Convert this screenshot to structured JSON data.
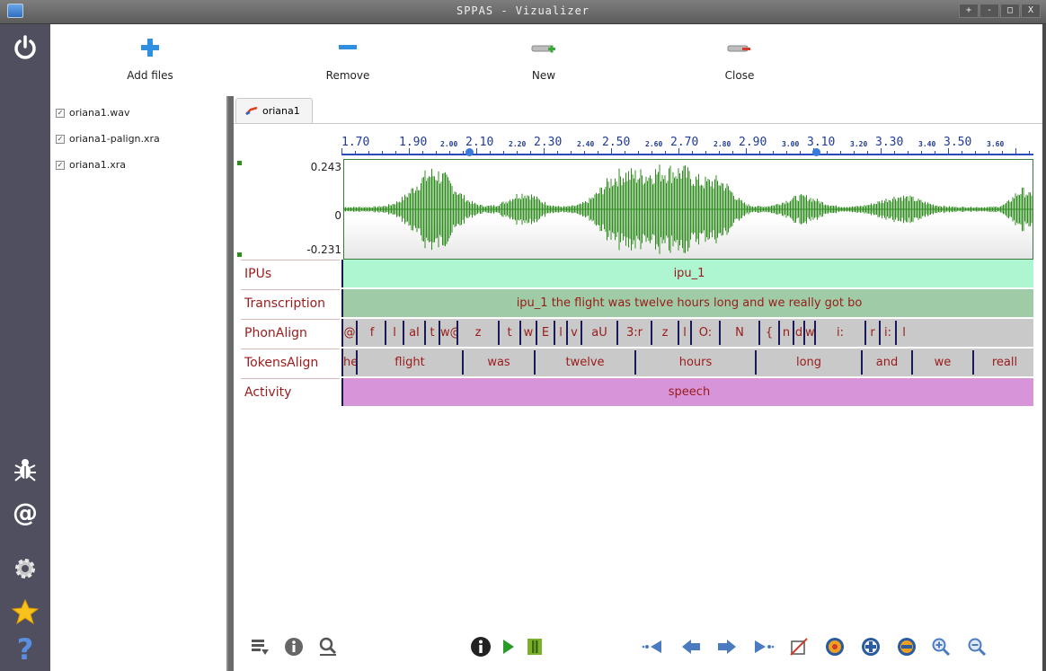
{
  "window": {
    "title": "SPPAS - Vizualizer",
    "controls": [
      "+",
      "-",
      "□",
      "X"
    ]
  },
  "sidebar": {
    "top": {
      "icon": "power-icon"
    },
    "bottom": [
      {
        "icon": "bug-icon"
      },
      {
        "icon": "at-sign-icon"
      },
      {
        "icon": "gear-icon"
      },
      {
        "icon": "star-icon"
      },
      {
        "icon": "help-icon"
      }
    ]
  },
  "toolbar": {
    "add_label": "Add files",
    "remove_label": "Remove",
    "new_label": "New",
    "close_label": "Close"
  },
  "files": [
    {
      "name": "oriana1.wav",
      "checked": true
    },
    {
      "name": "oriana1-palign.xra",
      "checked": true
    },
    {
      "name": "oriana1.xra",
      "checked": true
    }
  ],
  "document": {
    "tab_label": "oriana1",
    "ruler": {
      "major": [
        "1.70",
        "1.90",
        "2.10",
        "2.30",
        "2.50",
        "2.70",
        "2.90",
        "3.10",
        "3.30",
        "3.50"
      ],
      "minor": [
        "2.00",
        "2.20",
        "2.40",
        "2.60",
        "2.80",
        "3.00",
        "3.20",
        "3.40",
        "3.60"
      ]
    },
    "waveform": {
      "ymax": "0.243",
      "yzero": "0",
      "ymin": "-0.231",
      "color": "#2e8b1e"
    },
    "tiers": [
      {
        "name": "IPUs",
        "color": "#aef5d2",
        "annotations": [
          {
            "label": "ipu_1"
          }
        ]
      },
      {
        "name": "Transcription",
        "color": "#9fcca6",
        "annotations": [
          {
            "label": "ipu_1 the flight was twelve hours long and we really got bo"
          }
        ]
      },
      {
        "name": "PhonAlign",
        "color": "#c9c9c9",
        "annotations": [
          {
            "label": "@"
          },
          {
            "label": "f"
          },
          {
            "label": "l"
          },
          {
            "label": "aI"
          },
          {
            "label": "t"
          },
          {
            "label": "w@"
          },
          {
            "label": "z"
          },
          {
            "label": "t"
          },
          {
            "label": "w"
          },
          {
            "label": "E"
          },
          {
            "label": "l"
          },
          {
            "label": "v"
          },
          {
            "label": "aU"
          },
          {
            "label": "3:r"
          },
          {
            "label": "z"
          },
          {
            "label": "l"
          },
          {
            "label": "O:"
          },
          {
            "label": "N"
          },
          {
            "label": "{"
          },
          {
            "label": "n"
          },
          {
            "label": "d"
          },
          {
            "label": "w"
          },
          {
            "label": "i:"
          },
          {
            "label": "r"
          },
          {
            "label": "i:"
          },
          {
            "label": "l"
          }
        ]
      },
      {
        "name": "TokensAlign",
        "color": "#c9c9c9",
        "annotations": [
          {
            "label": "he"
          },
          {
            "label": "flight"
          },
          {
            "label": "was"
          },
          {
            "label": "twelve"
          },
          {
            "label": "hours"
          },
          {
            "label": "long"
          },
          {
            "label": "and"
          },
          {
            "label": "we"
          },
          {
            "label": "reall"
          }
        ]
      },
      {
        "name": "Activity",
        "color": "#d894d8",
        "annotations": [
          {
            "label": "speech"
          }
        ]
      }
    ]
  },
  "bottombar": {
    "left": [
      "list-icon",
      "info-icon",
      "zoom-selection-icon"
    ],
    "center": [
      "info-icon",
      "play-icon",
      "pause-icon"
    ],
    "right": [
      "skip-to-start-icon",
      "rewind-icon",
      "forward-icon",
      "skip-to-end-icon",
      "crop-icon",
      "zoom-fit-icon",
      "zoom-in-period-icon",
      "zoom-out-period-icon",
      "zoom-in-icon",
      "zoom-out-icon"
    ]
  }
}
